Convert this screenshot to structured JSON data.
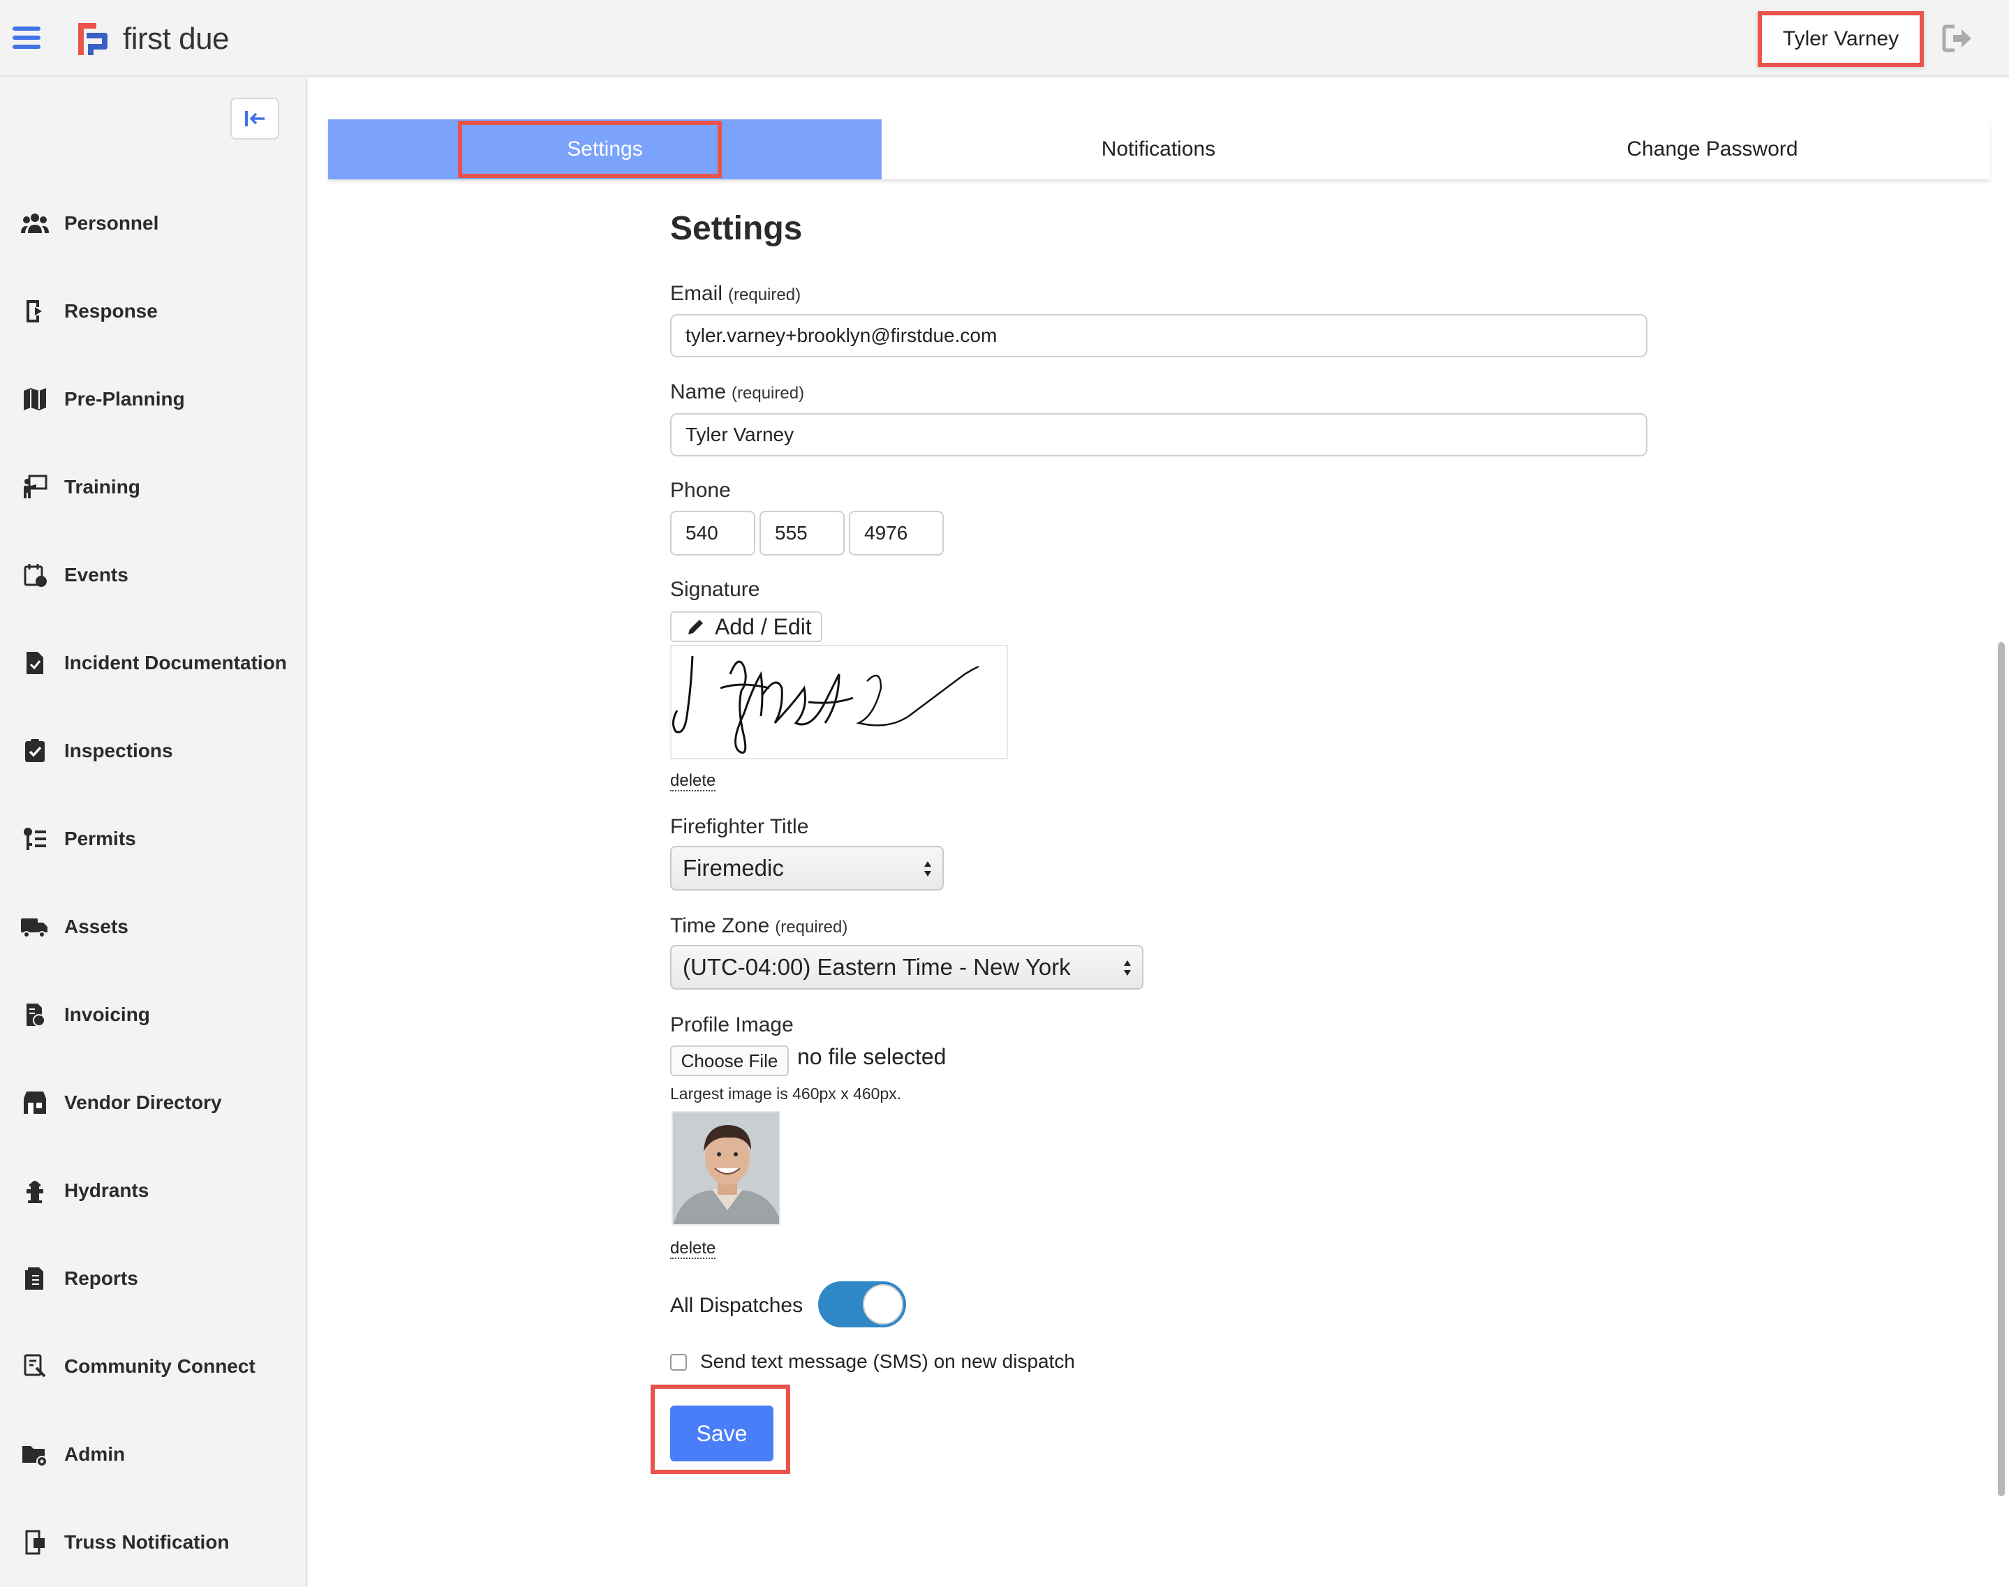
{
  "app": {
    "brand": "first due"
  },
  "header": {
    "user_name": "Tyler Varney"
  },
  "sidebar": {
    "items": [
      {
        "label": "Personnel",
        "icon": "users-icon"
      },
      {
        "label": "Response",
        "icon": "response-icon"
      },
      {
        "label": "Pre-Planning",
        "icon": "map-icon"
      },
      {
        "label": "Training",
        "icon": "training-icon"
      },
      {
        "label": "Events",
        "icon": "calendar-icon"
      },
      {
        "label": "Incident Documentation",
        "icon": "document-check-icon"
      },
      {
        "label": "Inspections",
        "icon": "clipboard-check-icon"
      },
      {
        "label": "Permits",
        "icon": "permit-icon"
      },
      {
        "label": "Assets",
        "icon": "truck-icon"
      },
      {
        "label": "Invoicing",
        "icon": "invoice-icon"
      },
      {
        "label": "Vendor Directory",
        "icon": "store-icon"
      },
      {
        "label": "Hydrants",
        "icon": "hydrant-icon"
      },
      {
        "label": "Reports",
        "icon": "report-icon"
      },
      {
        "label": "Community Connect",
        "icon": "community-icon"
      },
      {
        "label": "Admin",
        "icon": "folder-gear-icon"
      },
      {
        "label": "Truss Notification",
        "icon": "truss-icon"
      }
    ]
  },
  "tabs": [
    {
      "label": "Settings",
      "active": true
    },
    {
      "label": "Notifications",
      "active": false
    },
    {
      "label": "Change Password",
      "active": false
    }
  ],
  "form": {
    "title": "Settings",
    "email": {
      "label": "Email",
      "hint": "(required)",
      "value": "tyler.varney+brooklyn@firstdue.com"
    },
    "name": {
      "label": "Name",
      "hint": "(required)",
      "value": "Tyler Varney"
    },
    "phone": {
      "label": "Phone",
      "part1": "540",
      "part2": "555",
      "part3": "4976"
    },
    "signature": {
      "label": "Signature",
      "add_edit": "Add / Edit",
      "delete": "delete"
    },
    "firefighter_title": {
      "label": "Firefighter Title",
      "value": "Firemedic"
    },
    "time_zone": {
      "label": "Time Zone",
      "hint": "(required)",
      "value": "(UTC-04:00) Eastern Time - New York"
    },
    "profile_image": {
      "label": "Profile Image",
      "choose": "Choose File",
      "status": "no file selected",
      "hint": "Largest image is 460px x 460px.",
      "delete": "delete"
    },
    "all_dispatches": {
      "label": "All Dispatches",
      "on": true
    },
    "sms": {
      "label": "Send text message (SMS) on new dispatch",
      "checked": false
    },
    "save": "Save"
  },
  "colors": {
    "accent": "#4a7ef8",
    "tab_active": "#7ba3fb",
    "highlight": "#e9534a",
    "toggle_on": "#2f87c6"
  }
}
